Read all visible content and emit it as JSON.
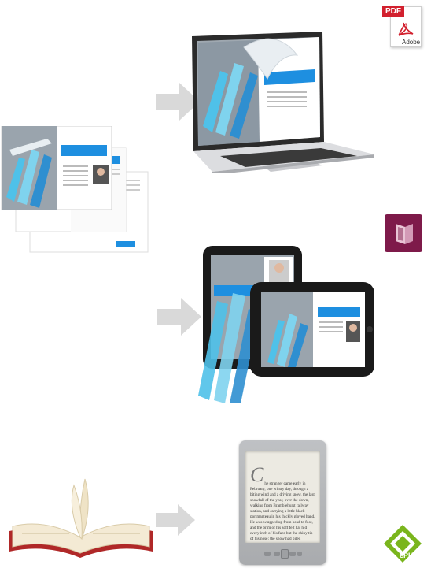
{
  "logos": {
    "pdf_label": "PDF",
    "pdf_vendor": "Adobe",
    "indd_label": "",
    "epub_label": "ePUB"
  },
  "ebook": {
    "drop_cap": "C",
    "text": "he stranger came early in February, one wintry day, through a biting wind and a driving snow, the last snowfall of the year, over the down, walking from Bramblehurst railway station, and carrying a little black portmanteau in his thickly gloved hand. He was wrapped up from head to foot, and the brim of his soft felt hat hid every inch of his face but the shiny tip of his nose; the snow had piled"
  },
  "colors": {
    "accent_blue": "#1e8fe0",
    "arrow_gray": "#d4d4d4",
    "indd_purple": "#7e1a4a",
    "epub_green": "#7ab51d",
    "pdf_red": "#d2202e"
  }
}
